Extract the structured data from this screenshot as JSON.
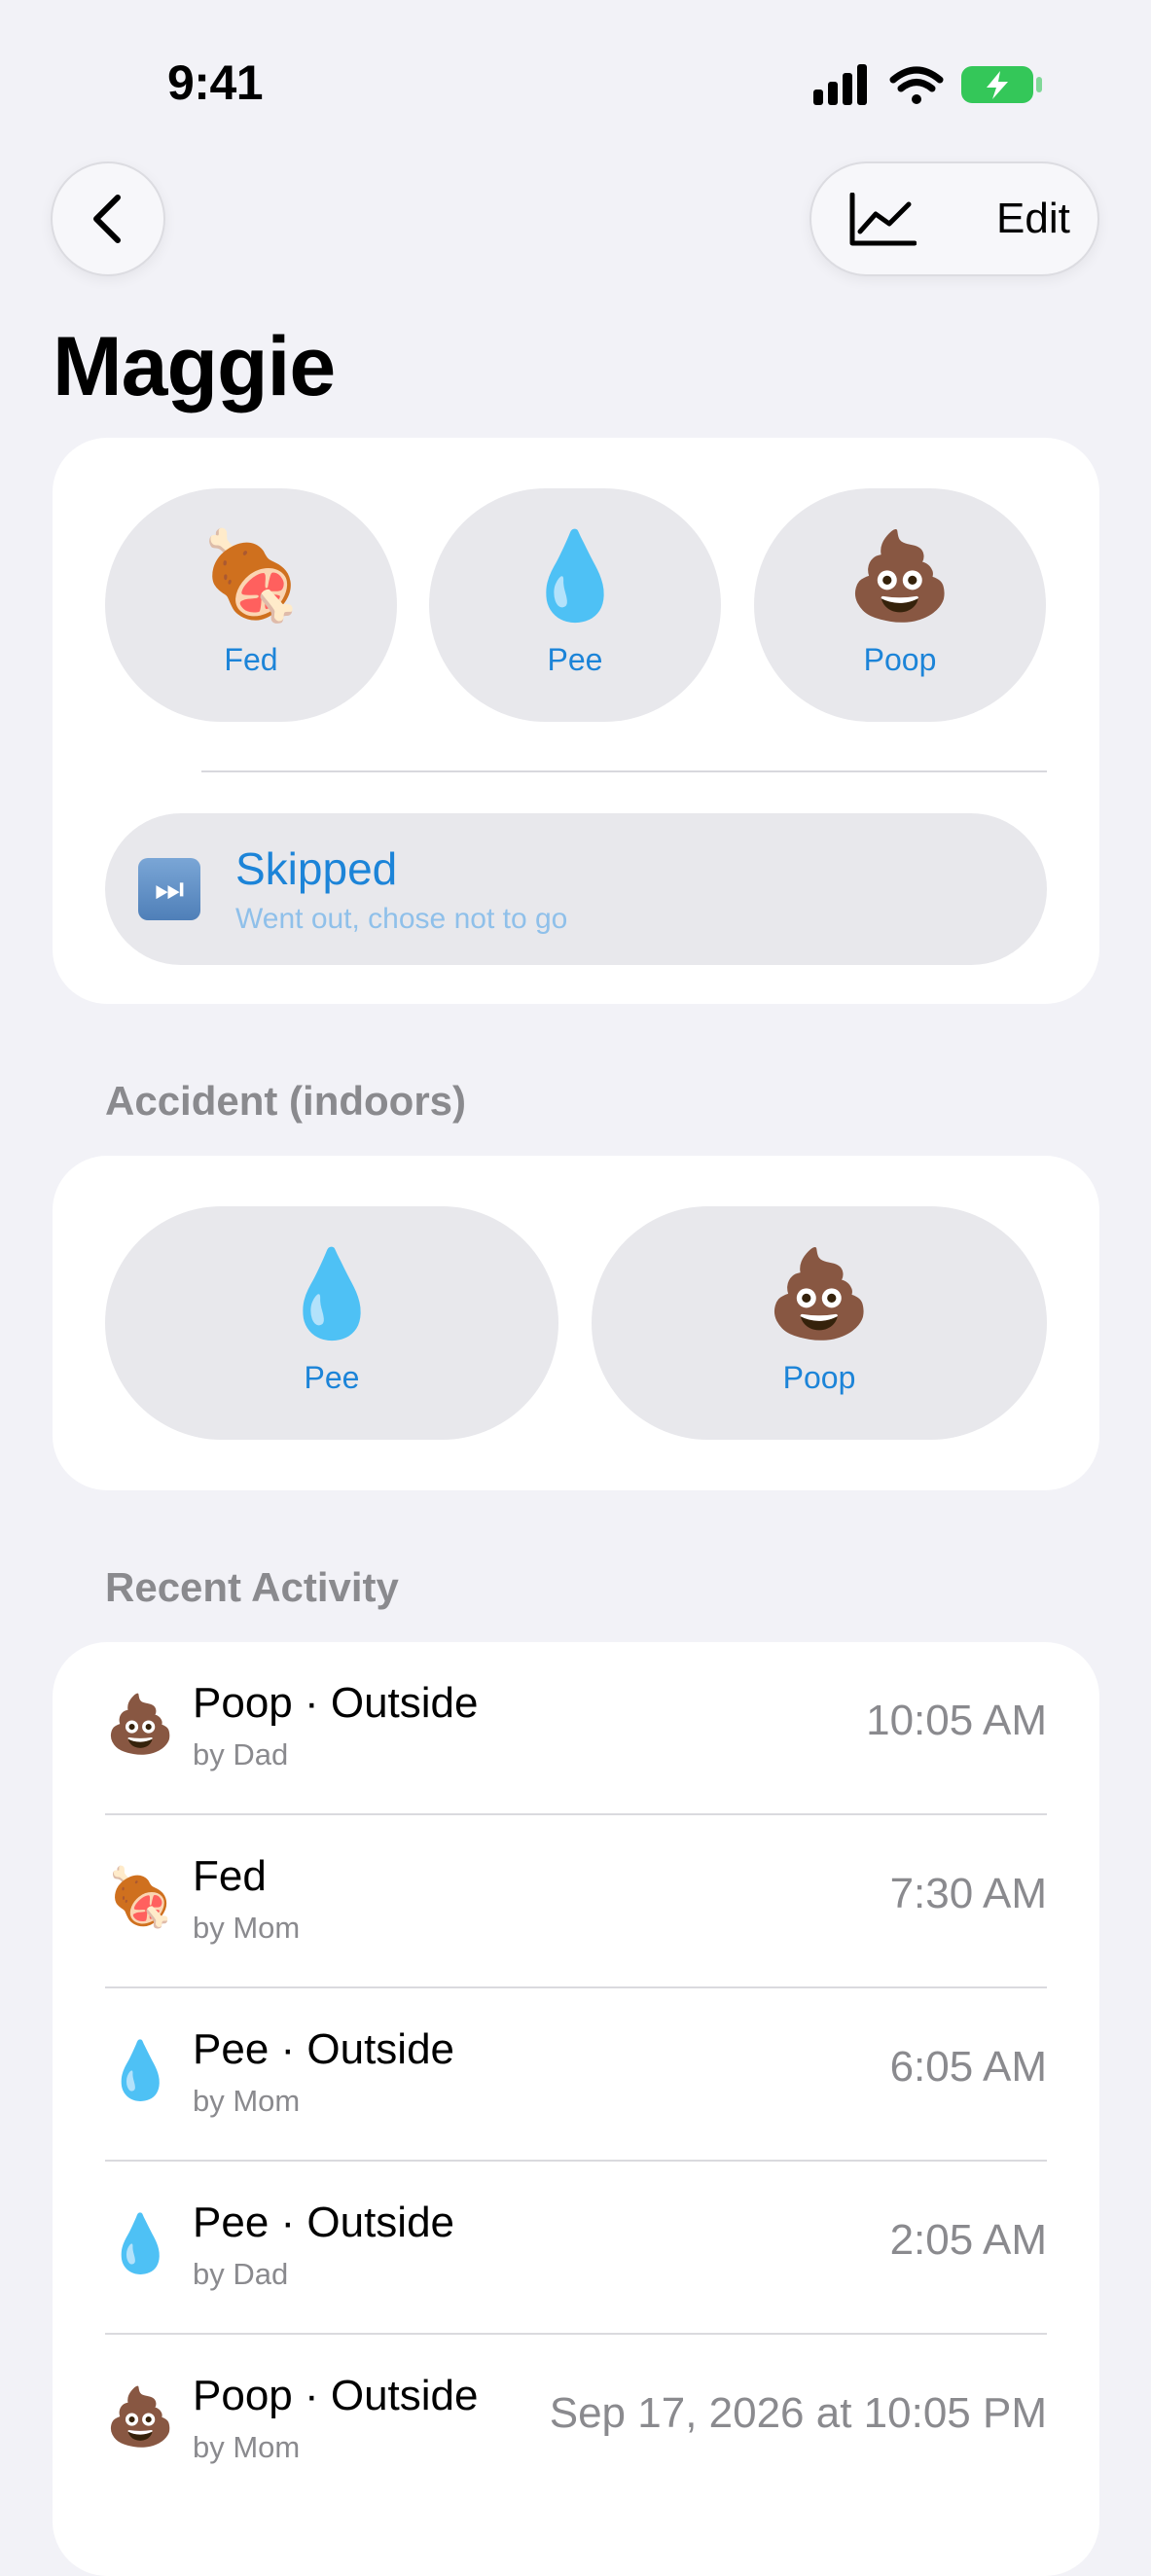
{
  "status_bar": {
    "time": "9:41"
  },
  "nav": {
    "back_icon": "chevron-left-icon",
    "chart_icon": "line-chart-icon",
    "edit_label": "Edit"
  },
  "title": "Maggie",
  "quick_actions": [
    {
      "emoji": "🍖",
      "label": "Fed"
    },
    {
      "emoji": "💧",
      "label": "Pee"
    },
    {
      "emoji": "💩",
      "label": "Poop"
    }
  ],
  "skipped": {
    "emoji": "⏭",
    "title": "Skipped",
    "subtitle": "Went out, chose not to go"
  },
  "accident": {
    "header": "Accident (indoors)",
    "buttons": [
      {
        "emoji": "💧",
        "label": "Pee"
      },
      {
        "emoji": "💩",
        "label": "Poop"
      }
    ]
  },
  "recent": {
    "header": "Recent Activity",
    "items": [
      {
        "emoji": "💩",
        "title": "Poop · Outside",
        "by": "by Dad",
        "time": "10:05 AM"
      },
      {
        "emoji": "🍖",
        "title": "Fed",
        "by": "by Mom",
        "time": "7:30 AM"
      },
      {
        "emoji": "💧",
        "title": "Pee · Outside",
        "by": "by Mom",
        "time": "6:05 AM"
      },
      {
        "emoji": "💧",
        "title": "Pee · Outside",
        "by": "by Dad",
        "time": "2:05 AM"
      },
      {
        "emoji": "💩",
        "title": "Poop · Outside",
        "by": "by Mom",
        "time": "Sep 17, 2026 at 10:05 PM"
      }
    ]
  },
  "colors": {
    "accent": "#1c84d8",
    "background": "#f2f2f7",
    "card": "#ffffff",
    "button": "#e8e8ec",
    "battery": "#34c759"
  }
}
